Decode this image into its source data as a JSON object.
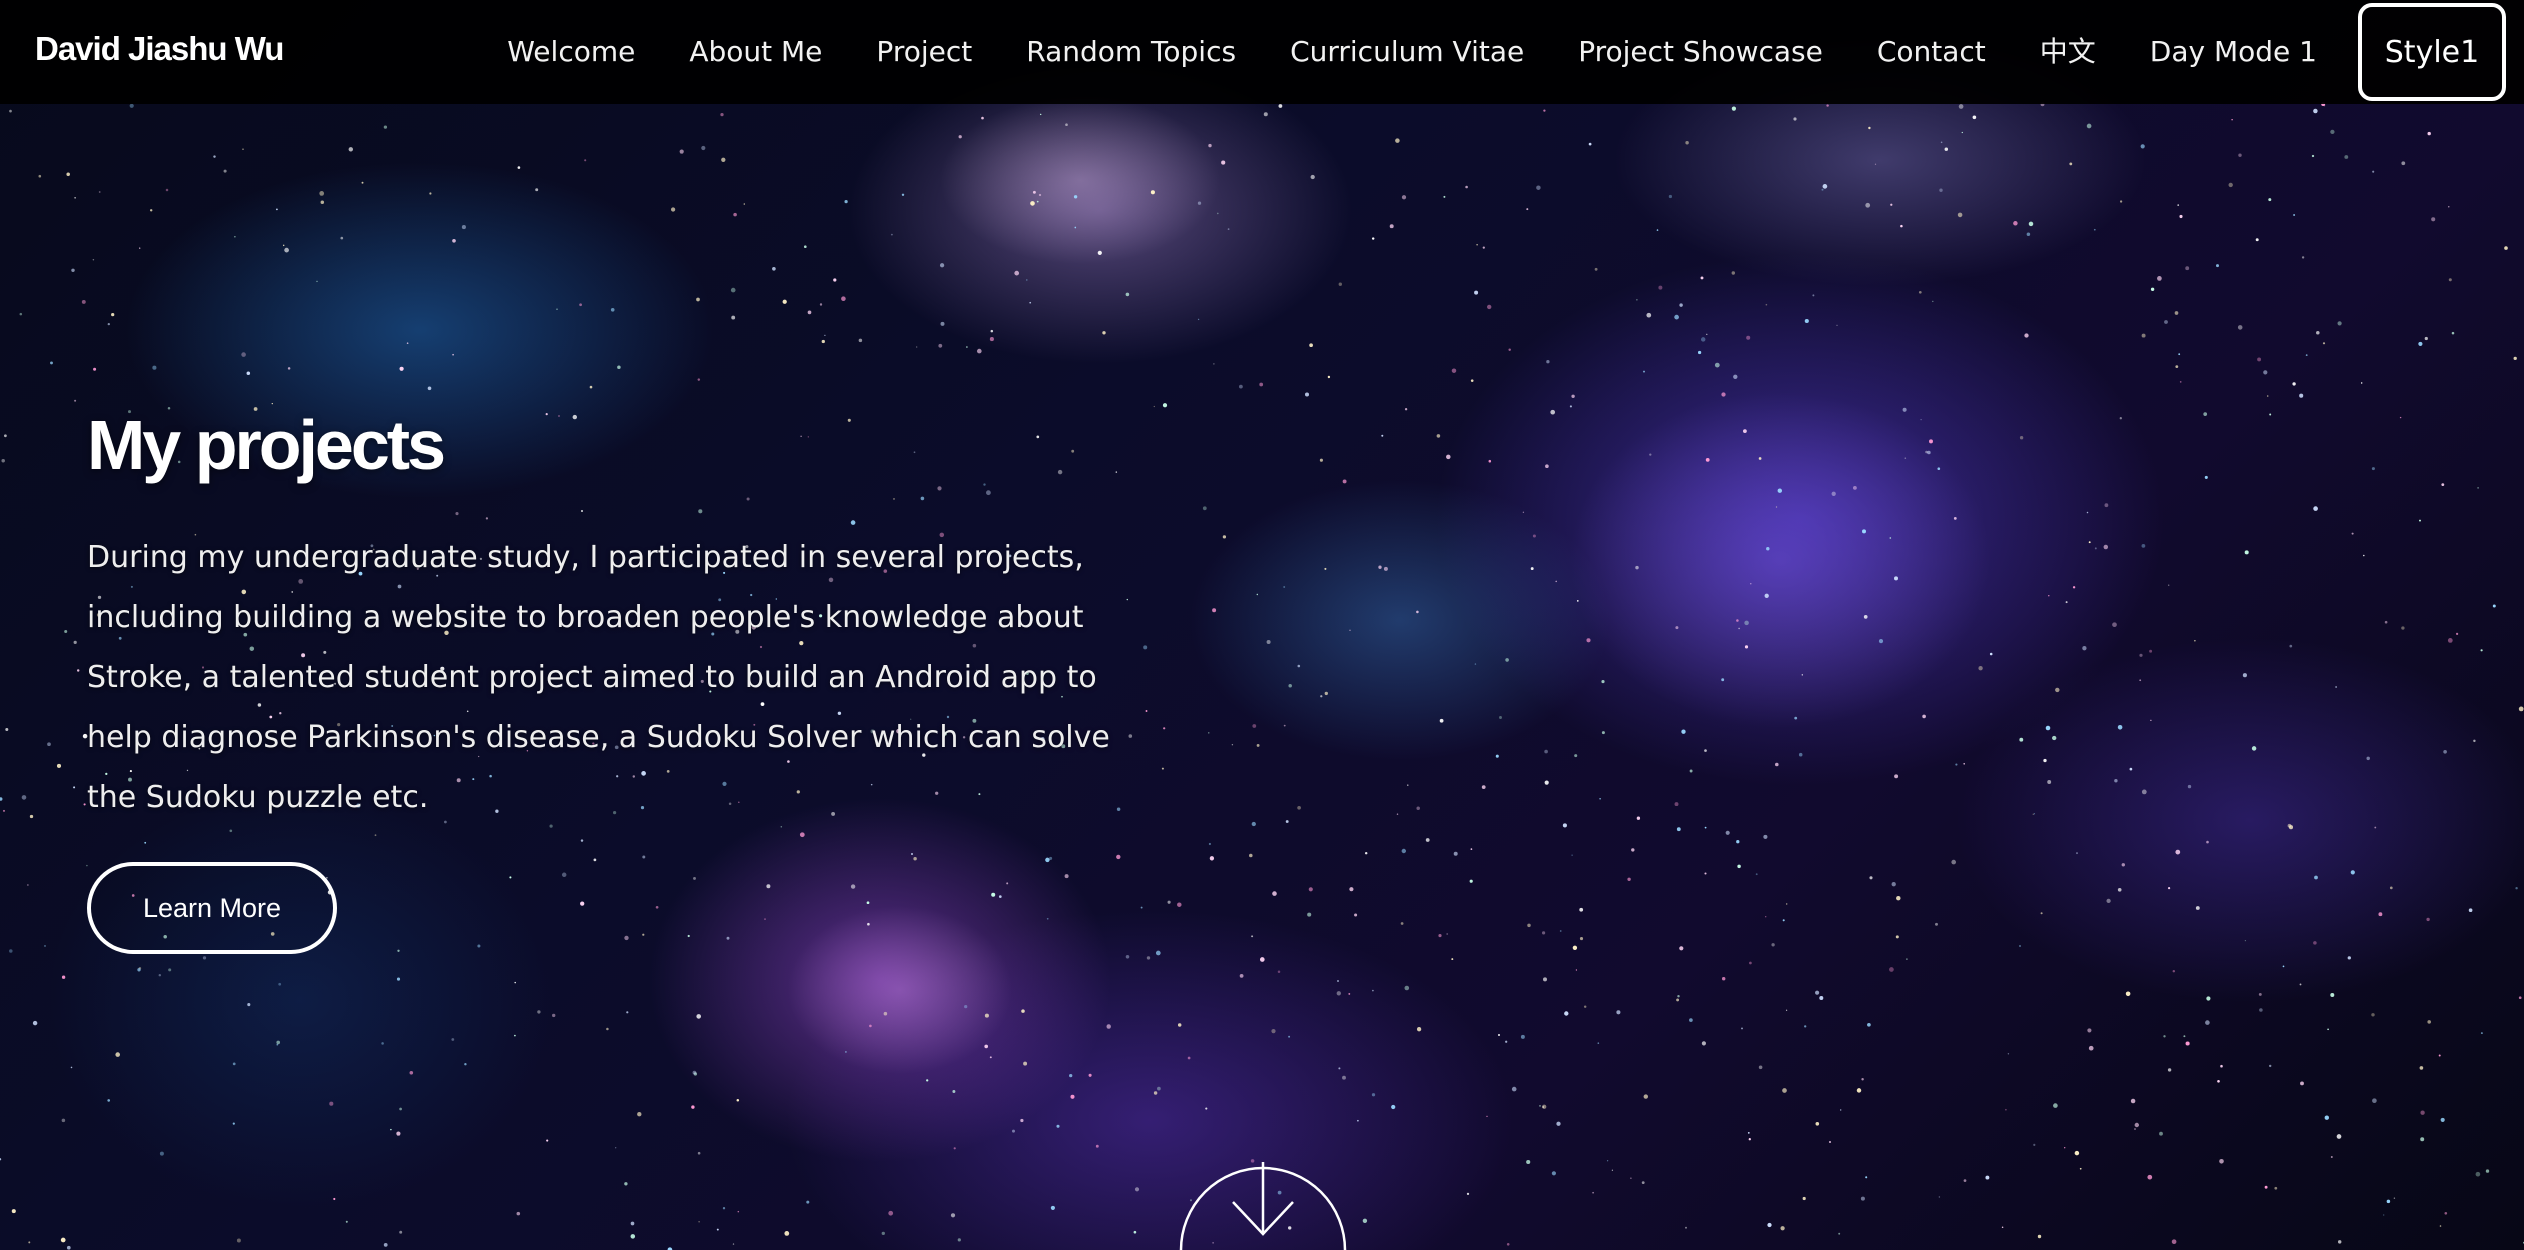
{
  "navbar": {
    "brand": "David Jiashu Wu",
    "links": [
      {
        "label": "Welcome"
      },
      {
        "label": "About Me"
      },
      {
        "label": "Project"
      },
      {
        "label": "Random Topics"
      },
      {
        "label": "Curriculum Vitae"
      },
      {
        "label": "Project Showcase"
      },
      {
        "label": "Contact"
      },
      {
        "label": "中文"
      },
      {
        "label": "Day Mode 1"
      }
    ],
    "style_button": "Style1"
  },
  "hero": {
    "title": "My projects",
    "description": "During my undergraduate study, I participated in several projects, including building a website to broaden people's knowledge about Stroke, a talented student project aimed to build an Android app to help diagnose Parkinson's disease, a Sudoku Solver which can solve the Sudoku puzzle etc.",
    "learn_more_label": "Learn More"
  },
  "icons": {
    "scroll_down": "arrow-down-icon"
  },
  "colors": {
    "navbar_bg": "#000000",
    "text": "#ffffff"
  }
}
